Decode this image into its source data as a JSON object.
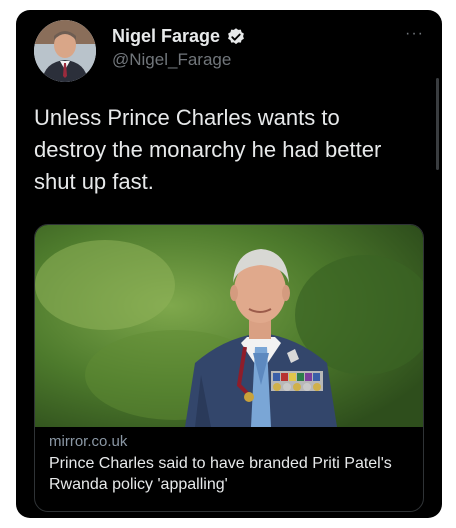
{
  "tweet": {
    "author_name": "Nigel Farage",
    "author_handle": "@Nigel_Farage",
    "verified": true,
    "text": "Unless Prince Charles wants to destroy the monarchy he had better shut up fast.",
    "more_icon": "more-horizontal-icon"
  },
  "link_card": {
    "domain": "mirror.co.uk",
    "title": "Prince Charles said to have branded Priti Patel's Rwanda policy 'appalling'"
  },
  "colors": {
    "background": "#000000",
    "text_primary": "#e7e9ea",
    "text_secondary": "#71767b",
    "verified_badge": "#e7e9ea"
  }
}
